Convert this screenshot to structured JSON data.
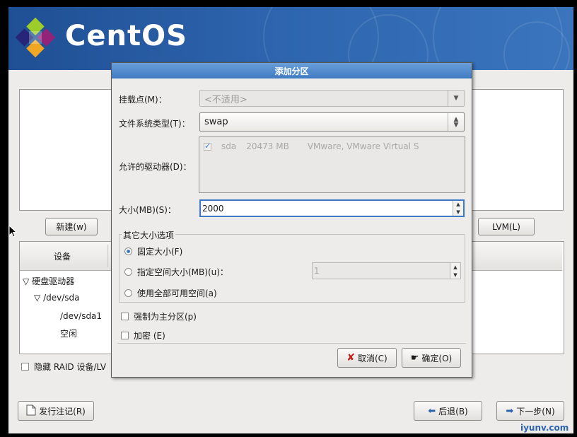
{
  "banner": {
    "brand": "CentOS"
  },
  "background": {
    "new_button": "新建(w)",
    "lvm_button": "LVM(L)",
    "table_header_device": "设备",
    "tree": {
      "hard_drives": "硬盘驱动器",
      "dev_sda": "/dev/sda",
      "dev_sda1": "/dev/sda1",
      "free": "空闲"
    },
    "hide_raid_label": "隐藏 RAID 设备/LV",
    "release_notes_button": "发行注记(R)",
    "back_button": "后退(B)",
    "next_button": "下一步(N)"
  },
  "dialog": {
    "title": "添加分区",
    "mount_point_label": "挂载点(M)：",
    "mount_point_value": "<不适用>",
    "fs_type_label": "文件系统类型(T)：",
    "fs_type_value": "swap",
    "allowed_drives_label": "允许的驱动器(D)：",
    "drive": {
      "name": "sda",
      "size": "20473 MB",
      "model": "VMware, VMware Virtual S",
      "checked": true
    },
    "size_label": "大小(MB)(S)：",
    "size_value": "2000",
    "other_size_group": "其它大小选项",
    "fixed_size": "固定大小(F)",
    "fill_up_to": "指定空间大小(MB)(u)：",
    "fill_up_to_value": "1",
    "fill_all": "使用全部可用空间(a)",
    "force_primary": "强制为主分区(p)",
    "encrypt": "加密 (E)",
    "cancel_button": "取消(C)",
    "ok_button": "确定(O)"
  },
  "watermark": "iyunv.com",
  "colors": {
    "accent": "#3f7bc3",
    "banner": "#2d64ad"
  }
}
